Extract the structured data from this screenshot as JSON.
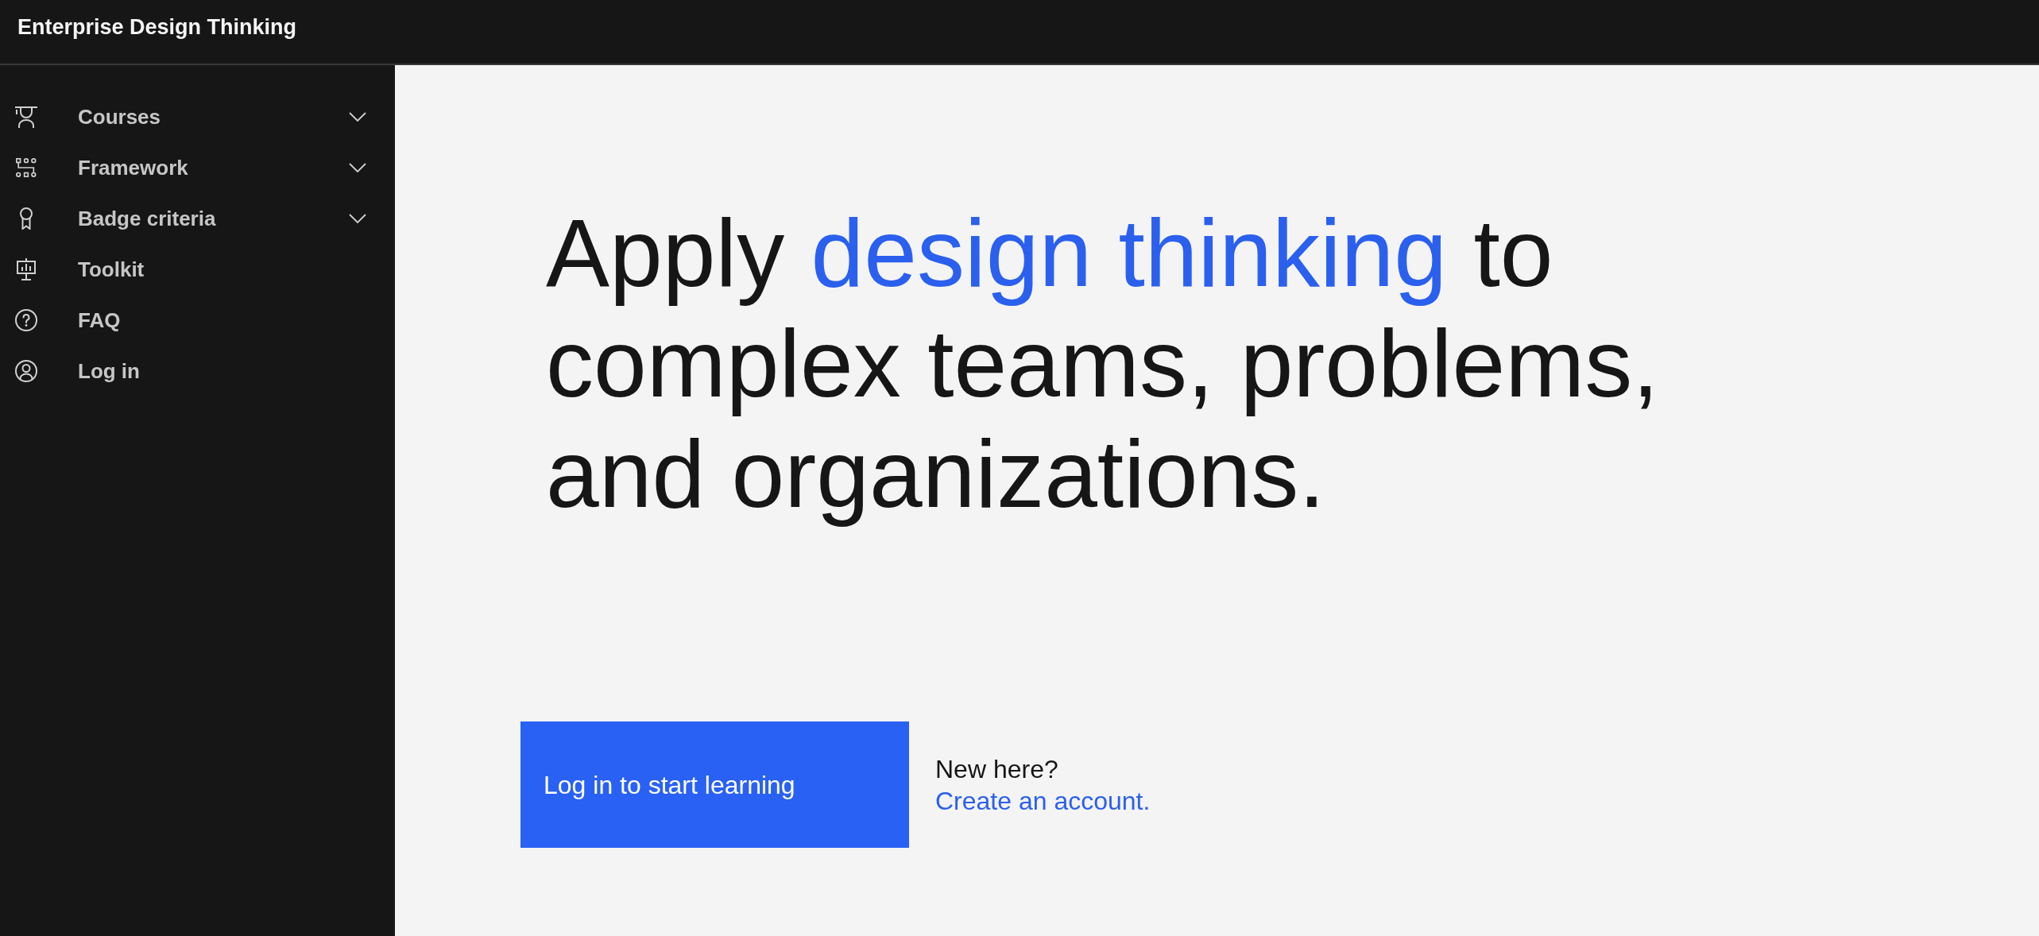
{
  "header": {
    "title": "Enterprise Design Thinking"
  },
  "sidebar": {
    "items": [
      {
        "label": "Courses",
        "kind": "group",
        "expanded": false
      },
      {
        "label": "Framework",
        "kind": "group",
        "expanded": false
      },
      {
        "label": "Badge criteria",
        "kind": "group",
        "expanded": false
      },
      {
        "label": "Toolkit",
        "kind": "link"
      },
      {
        "label": "FAQ",
        "kind": "link"
      },
      {
        "label": "Log in",
        "kind": "link"
      }
    ]
  },
  "hero": {
    "headline": [
      {
        "text": "Apply ",
        "highlighted": false
      },
      {
        "text": "design thinking",
        "highlighted": true
      },
      {
        "text": " to complex teams, problems, and organizations.",
        "highlighted": false
      }
    ],
    "cta_button": "Log in to start learning",
    "signup": {
      "prompt": "New here?",
      "link": "Create an account."
    }
  }
}
